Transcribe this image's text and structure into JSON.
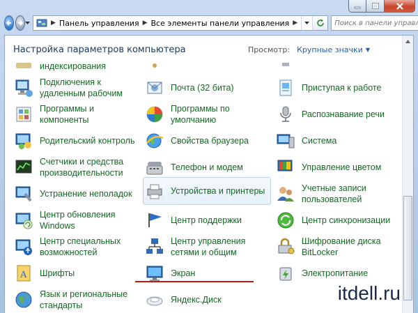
{
  "address": {
    "crumbs": [
      "Панель управления",
      "Все элементы панели управления"
    ]
  },
  "search": {
    "placeholder": "Поиск в панели управления"
  },
  "header": {
    "title": "Настройка параметров компьютера",
    "view_by_label": "Просмотр:",
    "view_by_value": "Крупные значки"
  },
  "items": {
    "col1": [
      {
        "label": "индексирования",
        "icon": "indexing-icon"
      },
      {
        "label": "Подключения к удаленным рабочим",
        "icon": "remote-desktop-icon"
      },
      {
        "label": "Программы и компоненты",
        "icon": "programs-features-icon"
      },
      {
        "label": "Родительский контроль",
        "icon": "parental-controls-icon"
      },
      {
        "label": "Счетчики и средства производительности",
        "icon": "performance-icon"
      },
      {
        "label": "Устранение неполадок",
        "icon": "troubleshooting-icon"
      },
      {
        "label": "Центр обновления Windows",
        "icon": "windows-update-icon"
      },
      {
        "label": "Центр специальных возможностей",
        "icon": "ease-of-access-icon"
      },
      {
        "label": "Шрифты",
        "icon": "fonts-icon"
      },
      {
        "label": "Язык и региональные стандарты",
        "icon": "region-language-icon"
      }
    ],
    "col2": [
      {
        "label": "Почта (32 бита)",
        "icon": "mail-icon"
      },
      {
        "label": "Программы по умолчанию",
        "icon": "default-programs-icon"
      },
      {
        "label": "Свойства браузера",
        "icon": "internet-options-icon"
      },
      {
        "label": "Телефон и модем",
        "icon": "phone-modem-icon"
      },
      {
        "label": "Устройства и принтеры",
        "icon": "devices-printers-icon"
      },
      {
        "label": "Центр поддержки",
        "icon": "action-center-icon"
      },
      {
        "label": "Центр управления сетями и общим",
        "icon": "network-center-icon"
      },
      {
        "label": "Экран",
        "icon": "display-icon"
      },
      {
        "label": "Яндекс.Диск",
        "icon": "yandex-disk-icon"
      }
    ],
    "col3": [
      {
        "label": "Приступая к работе",
        "icon": "getting-started-icon"
      },
      {
        "label": "Распознавание речи",
        "icon": "speech-recognition-icon"
      },
      {
        "label": "Система",
        "icon": "system-icon"
      },
      {
        "label": "Управление цветом",
        "icon": "color-management-icon"
      },
      {
        "label": "Учетные записи пользователей",
        "icon": "user-accounts-icon"
      },
      {
        "label": "Центр синхронизации",
        "icon": "sync-center-icon"
      },
      {
        "label": "Шифрование диска BitLocker",
        "icon": "bitlocker-icon"
      },
      {
        "label": "Электропитание",
        "icon": "power-options-icon"
      }
    ]
  },
  "watermark": "itdell.ru",
  "colors": {
    "link_green": "#0f6b1f",
    "underline_red": "#c51616"
  }
}
